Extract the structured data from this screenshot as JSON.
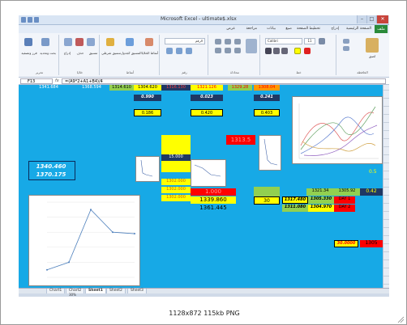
{
  "window": {
    "title": "Microsoft Excel - ultimate$.xlsx",
    "controls": [
      "–",
      "□",
      "✕"
    ]
  },
  "menu": {
    "file": "ملف",
    "tabs": [
      "الصفحة الرئيسية",
      "إدراج",
      "تخطيط الصفحة",
      "صيغ",
      "بيانات",
      "مراجعة",
      "عرض"
    ]
  },
  "ribbon": {
    "groups": [
      {
        "label": "تحرير",
        "items": [
          "فرز وتصفية",
          "بحث وتحديد"
        ]
      },
      {
        "label": "خلايا",
        "items": [
          "إدراج",
          "حذف",
          "تنسيق"
        ]
      },
      {
        "label": "أنماط",
        "items": [
          "تنسيق شرطي",
          "التنسيق كجدول",
          "أنماط الخلايا"
        ]
      },
      {
        "label": "رقم",
        "items": [
          "الرقم"
        ]
      },
      {
        "label": "محاذاة",
        "items": []
      },
      {
        "label": "خط",
        "items": [
          "Calibri",
          "11"
        ]
      },
      {
        "label": "الحافظة",
        "items": [
          "لصق"
        ]
      }
    ]
  },
  "formula_bar": {
    "name_box": "F13",
    "fx": "fx",
    "formula": "=(A9*2+A1+B4)/4"
  },
  "cells": {
    "top_row": [
      "1341.684",
      "1368.594",
      "1314.610",
      "1304.620",
      "1316.130",
      "1321.126",
      "1329.28",
      "1308.04"
    ],
    "row2": [
      "0.990",
      "0.023",
      "0.241"
    ],
    "row3": [
      "0.186",
      "0.420",
      "0.403"
    ],
    "left_box": [
      "1340.460",
      "1370.175"
    ],
    "red_box": "1313.5",
    "mid_values": [
      "1.000",
      "1339.860",
      "1361.445"
    ],
    "small_yellow": [
      "15.000",
      "1302.000",
      "1302.000",
      "1302.000"
    ],
    "right_block": {
      "val_30": "30",
      "r1": [
        "1321.34",
        "1305.92",
        "0.42"
      ],
      "r2": [
        "1317.480",
        "1305.330",
        "DAY 1"
      ],
      "r3": [
        "1311.080",
        "1304.970",
        "DAY 2"
      ],
      "bottom_yellow": "30.0000",
      "bottom_red": "1305",
      "side_yellow": "0.5"
    }
  },
  "sheet_tabs": [
    "Chart1",
    "Chart2",
    "Sheet1",
    "Sheet2",
    "Sheet3"
  ],
  "active_tab": "Sheet1",
  "status": {
    "zoom": "30%"
  },
  "caption": "1128x872 115kb PNG",
  "chart_data": [
    {
      "type": "line",
      "title": "",
      "x": [
        1,
        2,
        3,
        4,
        5
      ],
      "series": [
        {
          "values": [
            1305,
            1310,
            1345,
            1330,
            1329
          ]
        }
      ],
      "ylim": [
        1300,
        1350
      ]
    }
  ],
  "colors": {
    "sheet_bg": "#17a9e6",
    "yellow": "#ffff00",
    "red": "#ff0000",
    "green": "#92d050",
    "navy": "#1f3864",
    "file_tab": "#2a8a3a"
  }
}
